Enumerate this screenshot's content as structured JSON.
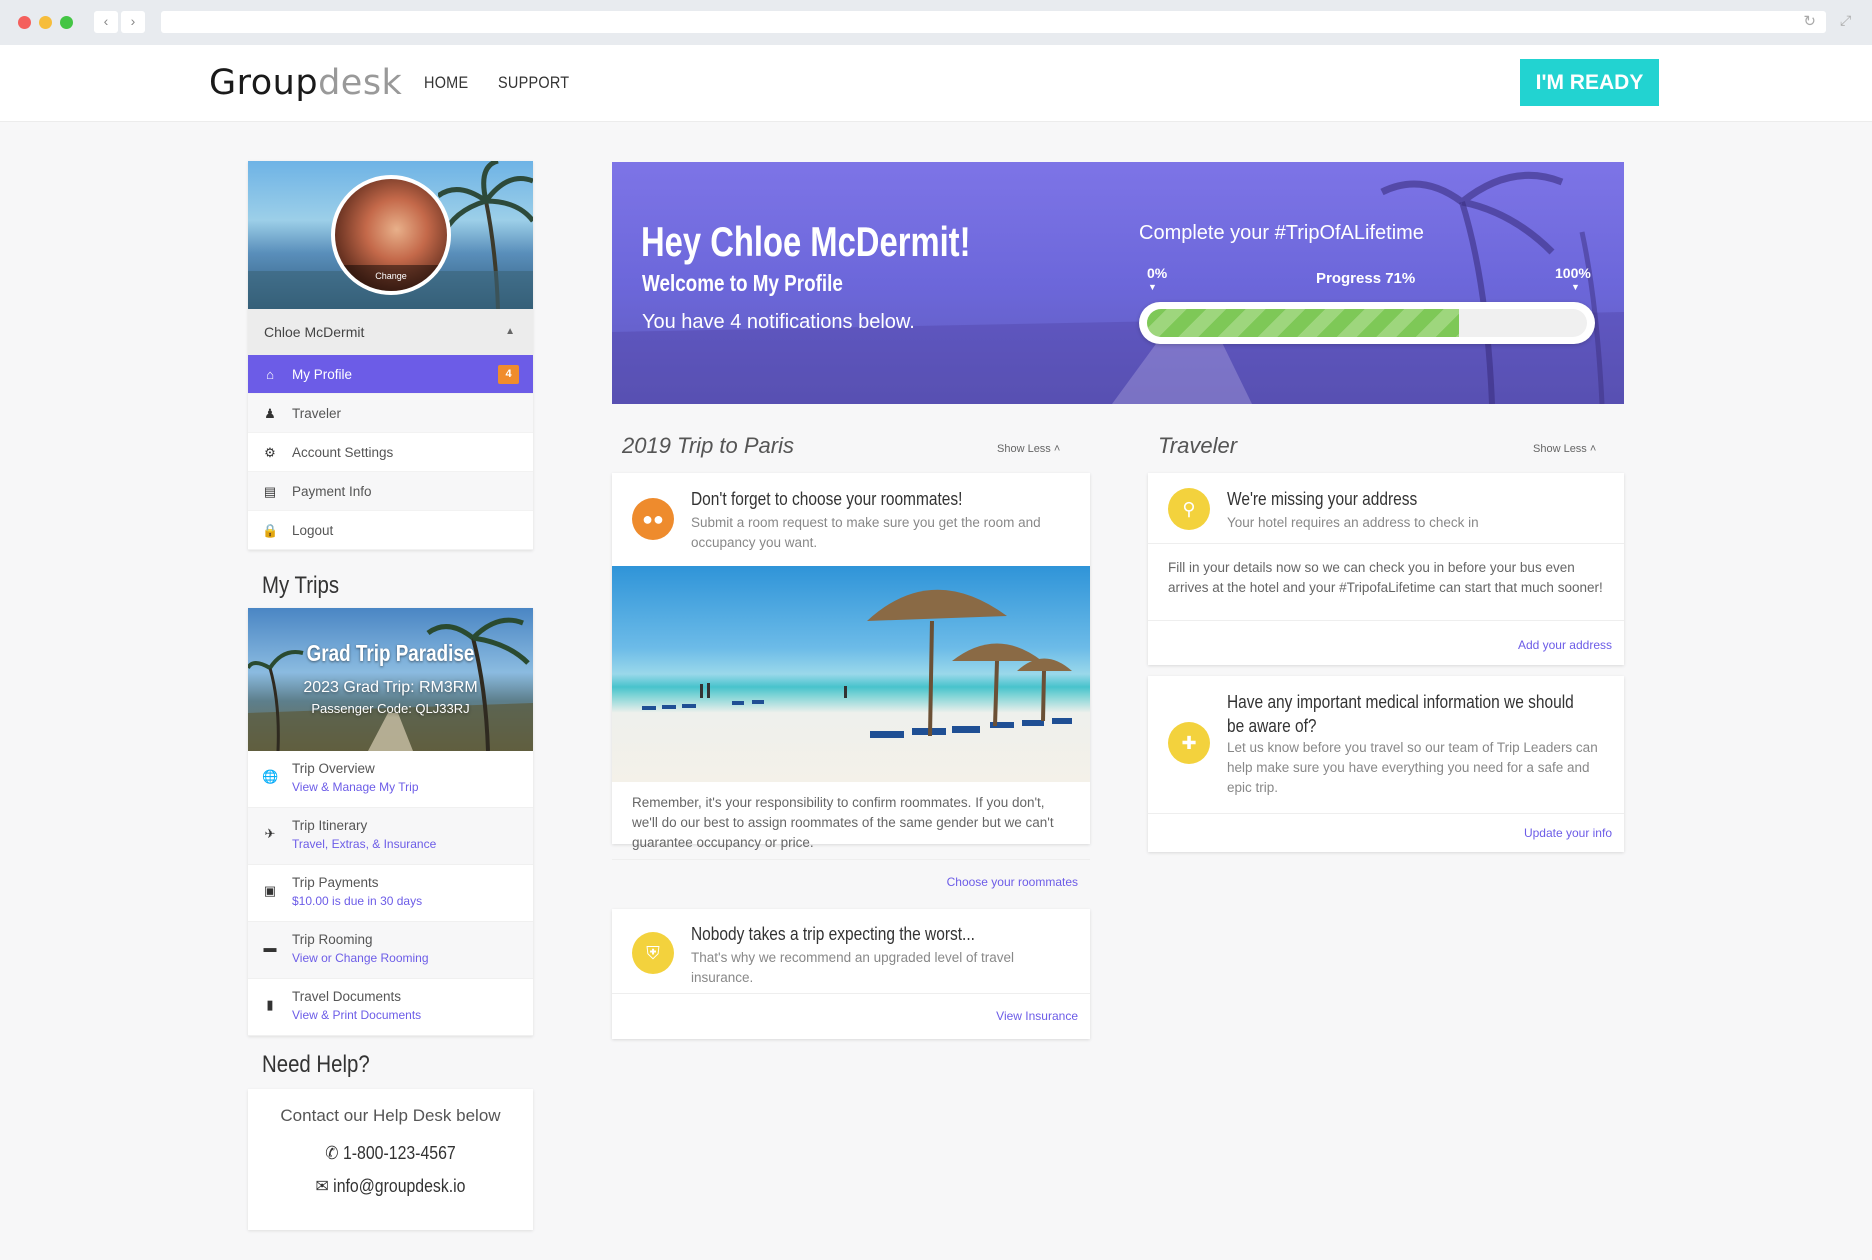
{
  "nav": {
    "logo_dark": "Group",
    "logo_light": "desk",
    "home": "HOME",
    "support": "SUPPORT",
    "ready_button": "I'M READY"
  },
  "profile": {
    "change_label": "Change",
    "name": "Chloe McDermit",
    "menu": [
      {
        "label": "My Profile",
        "icon": "home-icon",
        "badge": "4"
      },
      {
        "label": "Traveler",
        "icon": "user-icon"
      },
      {
        "label": "Account Settings",
        "icon": "gears-icon"
      },
      {
        "label": "Payment Info",
        "icon": "credit-card-icon"
      },
      {
        "label": "Logout",
        "icon": "lock-icon"
      }
    ]
  },
  "my_trips": {
    "title": "My Trips",
    "trip_name": "Grad Trip Paradise",
    "trip_code": "2023 Grad Trip: RM3RM",
    "passenger_code": "Passenger Code: QLJ33RJ",
    "items": [
      {
        "label": "Trip Overview",
        "sub": "View & Manage My Trip",
        "icon": "globe-icon"
      },
      {
        "label": "Trip Itinerary",
        "sub": "Travel, Extras, & Insurance",
        "icon": "plane-icon"
      },
      {
        "label": "Trip Payments",
        "sub": "$10.00 is due in 30 days",
        "icon": "money-icon"
      },
      {
        "label": "Trip Rooming",
        "sub": "View or Change Rooming",
        "icon": "bed-icon"
      },
      {
        "label": "Travel Documents",
        "sub": "View & Print Documents",
        "icon": "file-icon"
      }
    ]
  },
  "help": {
    "title": "Need Help?",
    "line": "Contact our Help Desk below",
    "phone": "1-800-123-4567",
    "email": "info@groupdesk.io"
  },
  "hero": {
    "greeting": "Hey Chloe McDermit!",
    "subtitle": "Welcome to My Profile",
    "notifications": "You have 4 notifications below.",
    "complete": "Complete your #TripOfALifetime",
    "min_label": "0%",
    "progress_label": "Progress 71%",
    "max_label": "100%",
    "progress_value": 0.71
  },
  "trip_column": {
    "title": "2019 Trip to Paris",
    "show_less": "Show Less",
    "roommates": {
      "title": "Don't forget to choose your roommates!",
      "desc": "Submit a room request to make sure you get the room and occupancy you want.",
      "body": "Remember, it's your responsibility to confirm roommates. If you don't, we'll do our best to assign roommates of the same gender but we can't guarantee occupancy or price.",
      "link": "Choose your roommates"
    },
    "insurance": {
      "title": "Nobody takes a trip expecting the worst...",
      "desc": "That's why we recommend an upgraded level of travel insurance.",
      "link": "View Insurance"
    }
  },
  "traveler_column": {
    "title": "Traveler",
    "show_less": "Show Less",
    "address": {
      "title": "We're missing your address",
      "desc": "Your hotel requires an address to check in",
      "body": "Fill in your details now so we can check you in before your bus even arrives at the hotel and your #TripofaLifetime can start that much sooner!",
      "link": "Add your address"
    },
    "medical": {
      "title": "Have any important medical information we should be aware of?",
      "desc": "Let us know before you travel so our team of Trip Leaders can help make sure you have everything you need for a safe and epic trip.",
      "link": "Update your info"
    }
  },
  "colors": {
    "accent": "#6c5ce7",
    "cta": "#22d3d1",
    "badge": "#f08c2c",
    "progress": "#7ec857",
    "icon_orange": "#ee8b2d",
    "icon_yellow": "#f3d23d"
  }
}
